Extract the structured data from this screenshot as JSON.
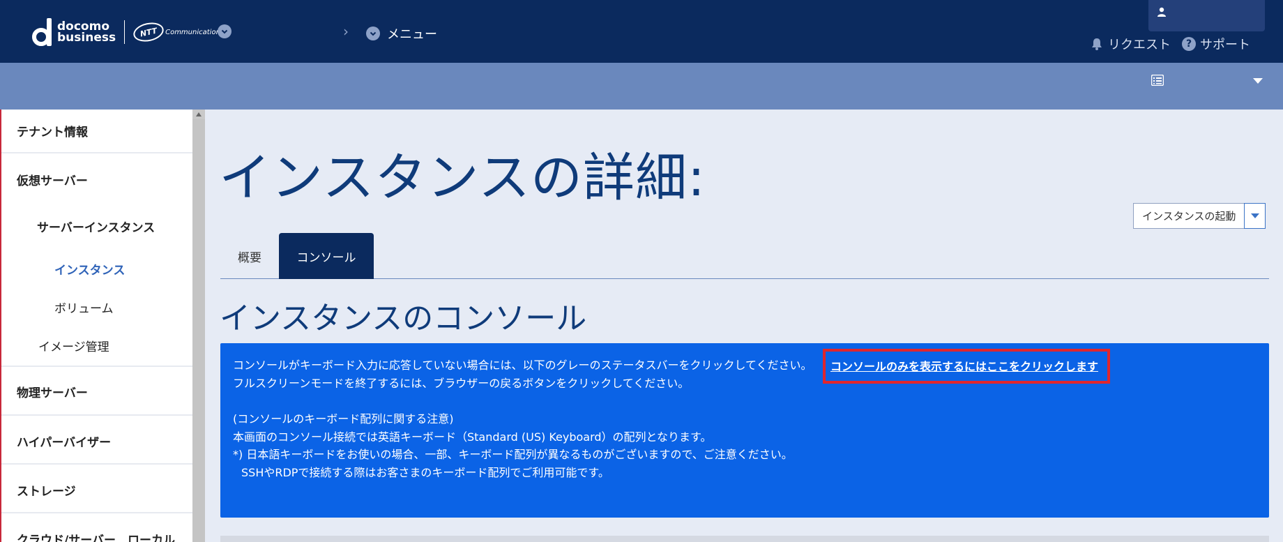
{
  "header": {
    "logo_docomo": "docomo",
    "logo_business": "business",
    "logo_ntt": "NTT",
    "logo_communications": "Communications",
    "menu_label": "メニュー",
    "request_label": "リクエスト",
    "support_label": "サポート",
    "icons": {
      "brand_dropdown": "chevron-down-icon",
      "breadcrumb": "chevron-right-icon",
      "user": "user-icon",
      "request": "bell-icon",
      "support": "question-icon",
      "list": "list-icon"
    }
  },
  "sidebar": {
    "items": [
      {
        "label": "テナント情報",
        "level": 0
      },
      {
        "label": "仮想サーバー",
        "level": 0
      },
      {
        "label": "サーバーインスタンス",
        "level": 1
      },
      {
        "label": "インスタンス",
        "level": 2,
        "active": true
      },
      {
        "label": "ボリューム",
        "level": 2
      },
      {
        "label": "イメージ管理",
        "level": 1
      },
      {
        "label": "物理サーバー",
        "level": 0
      },
      {
        "label": "ハイパーバイザー",
        "level": 0
      },
      {
        "label": "ストレージ",
        "level": 0
      },
      {
        "label": "クラウド/サーバー　ローカル",
        "level": 0
      }
    ]
  },
  "main": {
    "page_title": "インスタンスの詳細:",
    "action_button": "インスタンスの起動",
    "tabs": [
      {
        "label": "概要",
        "active": false
      },
      {
        "label": "コンソール",
        "active": true
      }
    ],
    "section_title": "インスタンスのコンソール",
    "info": {
      "line1": "コンソールがキーボード入力に応答していない場合には、以下のグレーのステータスバーをクリックしてください。",
      "link": "コンソールのみを表示するにはここをクリックします",
      "line2": "フルスクリーンモードを終了するには、ブラウザーの戻るボタンをクリックしてください。",
      "line3": "(コンソールのキーボード配列に関する注意)",
      "line4": "本画面のコンソール接続では英語キーボード（Standard (US) Keyboard）の配列となります。",
      "line5": "*) 日本語キーボードをお使いの場合、一部、キーボード配列が異なるものがございますので、ご注意ください。",
      "line6": "SSHやRDPで接続する際はお客さまのキーボード配列でご利用可能です。"
    }
  },
  "colors": {
    "header_bg": "#0b2a5e",
    "subbar_bg": "#6a88bd",
    "info_bg": "#0b63e6",
    "highlight": "#e0262d",
    "title": "#0f3b7a",
    "active_link": "#2f63b8"
  }
}
